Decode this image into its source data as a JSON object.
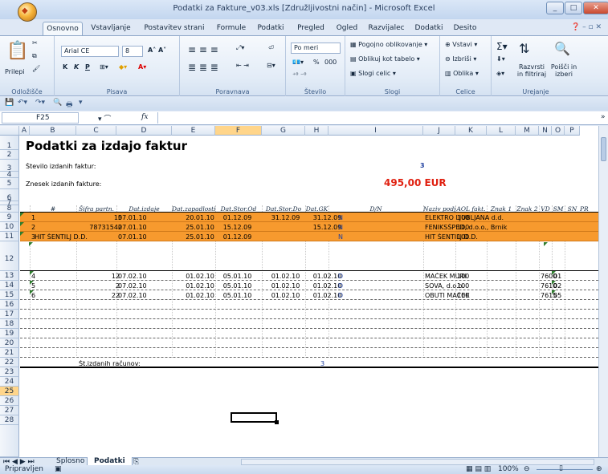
{
  "window": {
    "title": "Podatki za Fakture_v03.xls  [Združljivostni način]  -  Microsoft Excel"
  },
  "tabs": [
    "Osnovno",
    "Vstavljanje",
    "Postavitev strani",
    "Formule",
    "Podatki",
    "Pregled",
    "Ogled",
    "Razvijalec",
    "Dodatki",
    "Desito"
  ],
  "active_tab": "Osnovno",
  "ribbon": {
    "clipboard": {
      "paste": "Prilepi",
      "label": "Odložišče"
    },
    "font": {
      "name": "Arial CE",
      "size": "8",
      "bold": "K",
      "italic": "K",
      "underline": "P",
      "label": "Pisava"
    },
    "alignment": {
      "label": "Poravnava"
    },
    "number": {
      "format": "Po meri",
      "percent": "%",
      "thousands": "000",
      "label": "Število"
    },
    "styles": {
      "cond": "Pogojno oblikovanje",
      "table": "Oblikuj kot tabelo",
      "cell": "Slogi celic",
      "label": "Slogi"
    },
    "cells": {
      "insert": "Vstavi",
      "delete": "Izbriši",
      "format": "Oblika",
      "label": "Celice"
    },
    "editing": {
      "sort": "Razvrsti in filtriraj",
      "find": "Poišči in izberi",
      "label": "Urejanje"
    }
  },
  "formula_bar": {
    "cell_ref": "F25",
    "fx": "fx",
    "value": ""
  },
  "columns": [
    "A",
    "B",
    "C",
    "D",
    "E",
    "F",
    "G",
    "H",
    "I",
    "J",
    "K",
    "L",
    "M",
    "N",
    "O",
    "P"
  ],
  "sheet": {
    "title": "Podatki za izdajo faktur",
    "count_label": "Število izdanih faktur:",
    "count_value": "3",
    "amount_label": "Znesek izdanih fakture:",
    "amount_value": "495,00 EUR",
    "headers": [
      "#",
      "Šifra partn.",
      "Dat.izdaje",
      "Dat.zapadlosti",
      "Dat.Stor.Od",
      "Dat.Stor.Do",
      "Dat.GK",
      "D/N",
      "Naziv podjetja",
      "AOL fakt.",
      "Znak 1",
      "Znak 2",
      "VD",
      "SM",
      "SN",
      "PR"
    ],
    "orange_rows": [
      [
        "1",
        "15",
        "07.01.10",
        "20.01.10",
        "01.12.09",
        "31.12.09",
        "31.12.09",
        "N",
        "ELEKTRO LJUBLJANA d.d.",
        "100"
      ],
      [
        "2",
        "78731542",
        "07.01.10",
        "25.01.10",
        "15.12.09",
        "",
        "15.12.09",
        "N",
        "FENIKSŠPED, d.o.o., Brnik",
        "100"
      ],
      [
        "3",
        "HIT ŠENTILJ D.D.",
        "07.01.10",
        "25.01.10",
        "01.12.09",
        "",
        "",
        "N",
        "HIT ŠENTILJ D.D.",
        "100"
      ]
    ],
    "white_rows": [
      [
        "4",
        "12",
        "07.02.10",
        "01.02.10",
        "05.01.10",
        "01.02.10",
        "01.02.10",
        "D",
        "MAČEK MURI",
        "100",
        "7600",
        "01"
      ],
      [
        "5",
        "2",
        "07.02.10",
        "01.02.10",
        "05.01.10",
        "01.02.10",
        "01.02.10",
        "D",
        "SOVA, d.o.o.",
        "100",
        "7610",
        "02"
      ],
      [
        "6",
        "22",
        "07.02.10",
        "01.02.10",
        "05.01.10",
        "01.02.10",
        "01.02.10",
        "D",
        "OBUTI MAČEK",
        "100",
        "7615",
        "05"
      ]
    ],
    "footer_label": "Št.izdanih računov:",
    "footer_value": "3"
  },
  "sheet_tabs": [
    "Splosno",
    "Podatki"
  ],
  "active_sheet": "Podatki",
  "status": {
    "mode": "Pripravljen",
    "zoom": "100%"
  },
  "colors": {
    "orange": "#f79a2e",
    "accent_red": "#e02010",
    "blue": "#1f3f9f"
  }
}
